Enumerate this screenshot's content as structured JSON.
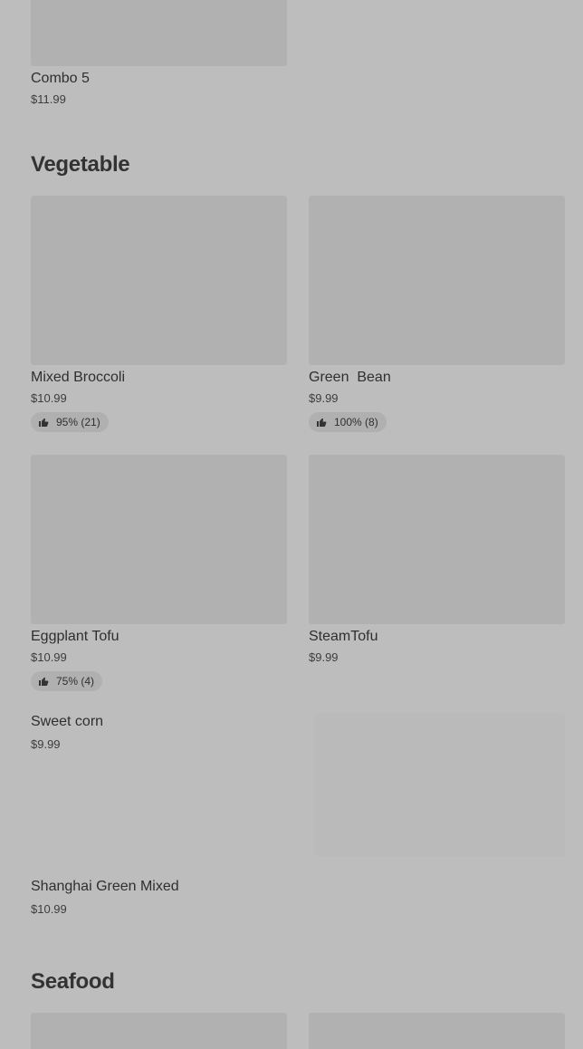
{
  "combo_section": {
    "item": {
      "name": "Combo 5",
      "price": "$11.99"
    }
  },
  "vegetable": {
    "title": "Vegetable",
    "items": [
      {
        "name": "Mixed Broccoli",
        "price": "$10.99",
        "rating": "95% (21)"
      },
      {
        "name": "Green  Bean",
        "price": "$9.99",
        "rating": "100% (8)"
      },
      {
        "name": "Eggplant Tofu",
        "price": "$10.99",
        "rating": "75% (4)"
      },
      {
        "name": "SteamTofu",
        "price": "$9.99"
      },
      {
        "name": "Sweet corn",
        "price": "$9.99"
      },
      {
        "name": "Shanghai Green Mixed",
        "price": "$10.99"
      }
    ]
  },
  "seafood": {
    "title": "Seafood"
  },
  "icons": {
    "rating": "thumbs-up-icon"
  },
  "colors": {
    "background": "#bdbdbd",
    "placeholder": "#b1b1b1",
    "badge": "#b0b0b0"
  }
}
